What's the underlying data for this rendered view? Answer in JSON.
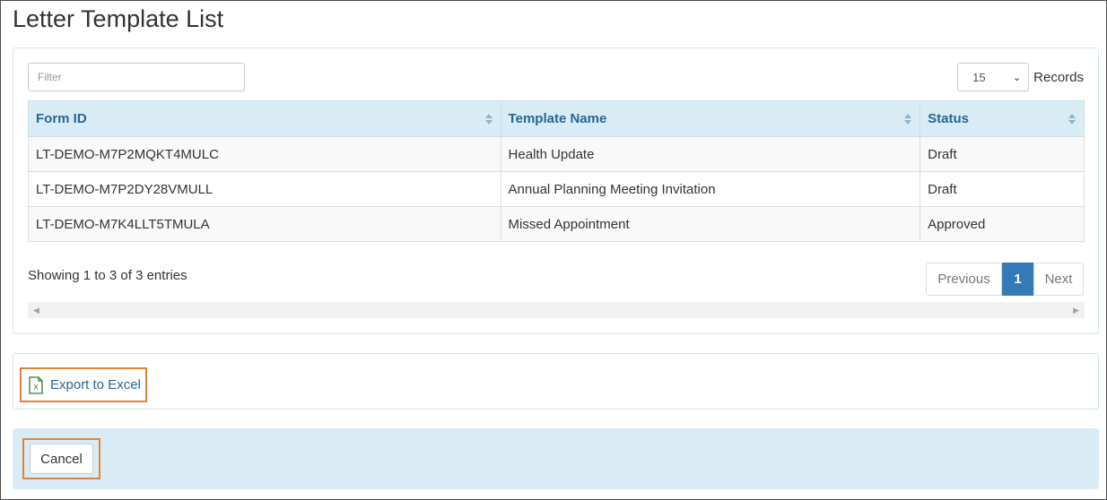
{
  "page": {
    "title": "Letter Template List"
  },
  "filter": {
    "placeholder": "Filter",
    "value": ""
  },
  "records": {
    "selected": "15",
    "label": "Records"
  },
  "table": {
    "columns": [
      "Form ID",
      "Template Name",
      "Status"
    ],
    "rows": [
      {
        "form_id": "LT-DEMO-M7P2MQKT4MULC",
        "template_name": "Health Update",
        "status": "Draft"
      },
      {
        "form_id": "LT-DEMO-M7P2DY28VMULL",
        "template_name": "Annual Planning Meeting Invitation",
        "status": "Draft"
      },
      {
        "form_id": "LT-DEMO-M7K4LLT5TMULA",
        "template_name": "Missed Appointment",
        "status": "Approved"
      }
    ]
  },
  "info": {
    "text": "Showing 1 to 3 of 3 entries"
  },
  "pagination": {
    "previous": "Previous",
    "current": "1",
    "next": "Next"
  },
  "scrollbar": {
    "left_arrow": "◀",
    "right_arrow": "▶"
  },
  "export": {
    "label": "Export to Excel",
    "icon": "excel-file-icon",
    "color": "#2e7d32"
  },
  "footer": {
    "cancel_label": "Cancel"
  },
  "colors": {
    "accent": "#337ab7",
    "header_bg": "#d9ecf5",
    "highlight": "#e0823a",
    "link": "#2a6496"
  }
}
